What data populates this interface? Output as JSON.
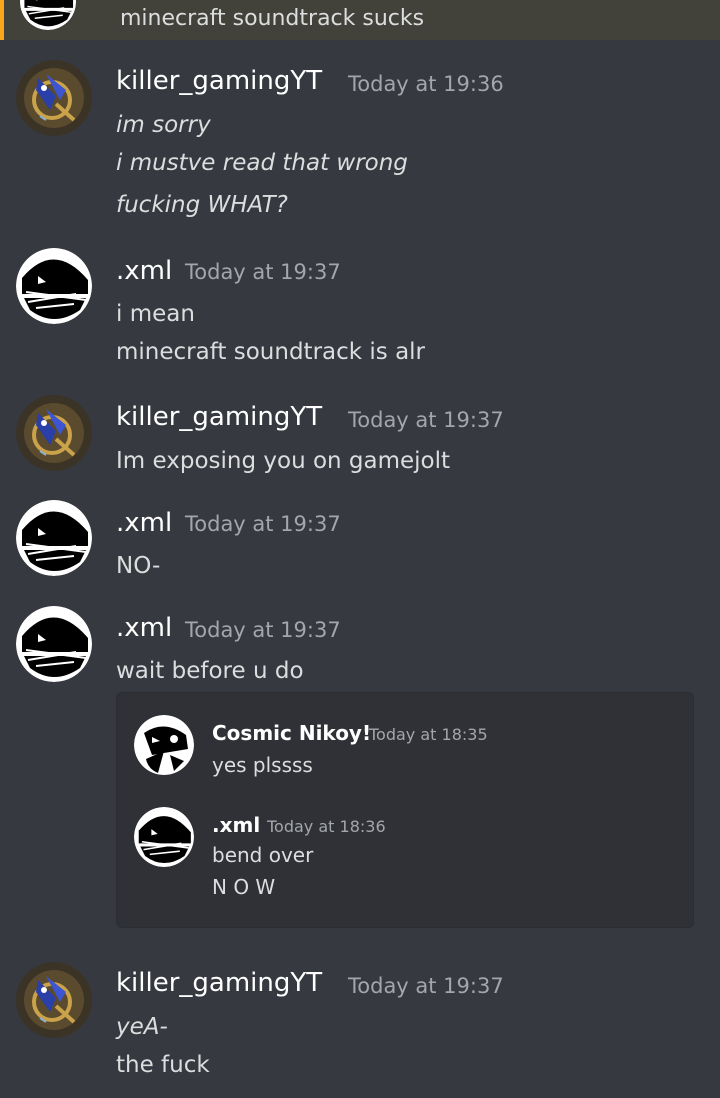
{
  "top_message": {
    "text": "minecraft soundtrack sucks",
    "avatar_icon": "masked-face-avatar-icon"
  },
  "messages": [
    {
      "author": "killer_gamingYT",
      "time": "Today at 19:36",
      "lines": [
        "im sorry",
        "i mustve read that wrong",
        "fucking WHAT?"
      ]
    },
    {
      "author": ".xml",
      "time": "Today at 19:37",
      "lines": [
        "i mean",
        "minecraft soundtrack is alr"
      ]
    },
    {
      "author": "killer_gamingYT",
      "time": "Today at 19:37",
      "lines": [
        "Im exposing you on gamejolt"
      ]
    },
    {
      "author": ".xml",
      "time": "Today at 19:37",
      "lines": [
        "NO-"
      ]
    },
    {
      "author": ".xml",
      "time": "Today at 19:37",
      "lines": [
        "wait before u do"
      ]
    },
    {
      "author": "killer_gamingYT",
      "time": "Today at 19:37",
      "lines": [
        "yeA-",
        "the fuck"
      ]
    }
  ],
  "embed": {
    "messages": [
      {
        "author": "Cosmic Nikoy!",
        "time": "Today at 18:35",
        "lines": [
          "yes plssss"
        ]
      },
      {
        "author": ".xml",
        "time": "Today at 18:36",
        "lines": [
          "bend over",
          "N O W"
        ]
      }
    ]
  },
  "colors": {
    "background": "#36393f",
    "highlight": "#43423a",
    "mention_bar": "#faa61a",
    "timestamp": "#a3a6aa",
    "text": "#dcddde",
    "embed_bg": "#2f3136"
  }
}
